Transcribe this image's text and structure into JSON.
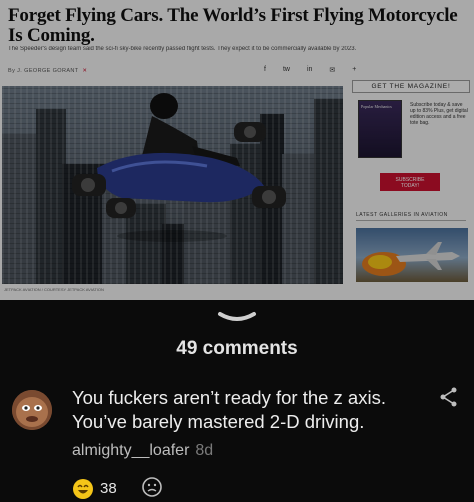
{
  "article": {
    "headline": "Forget Flying Cars. The World’s First Flying Motorcycle Is Coming.",
    "subhead": "The Speeder's design team said the sci-fi sky-bike recently passed flight tests. They expect it to be commercially available by 2023.",
    "byline": "By J. GEORGE GORANT",
    "share_icons": [
      "f",
      "tw",
      "in",
      "✉",
      "+"
    ],
    "photo_caption": "JETPACK AVIATION / COURTESY JETPACK AVIATION",
    "sidebar": {
      "title": "GET THE MAGAZINE!",
      "magazine_name": "Popular Mechanics",
      "promo_text": "Subscribe today & save up to 83% Plus, get digital edition access and a free tote bag.",
      "subscribe_label": "SUBSCRIBE TODAY!",
      "gallery_title": "LATEST GALLERIES IN AVIATION"
    }
  },
  "comments_section": {
    "count_label": "49 comments"
  },
  "comment": {
    "text": "You fuckers aren’t ready for the z axis. You’ve barely mastered 2-D driving.",
    "author": "almighty__loafer",
    "age": "8d",
    "reactions": {
      "laugh_count": "38"
    }
  },
  "colors": {
    "background": "#0b0b0b",
    "text_primary": "#ededed",
    "text_secondary": "#bdbdbd",
    "reaction_yellow": "#f5c518",
    "subscribe_red": "#c8102e"
  }
}
